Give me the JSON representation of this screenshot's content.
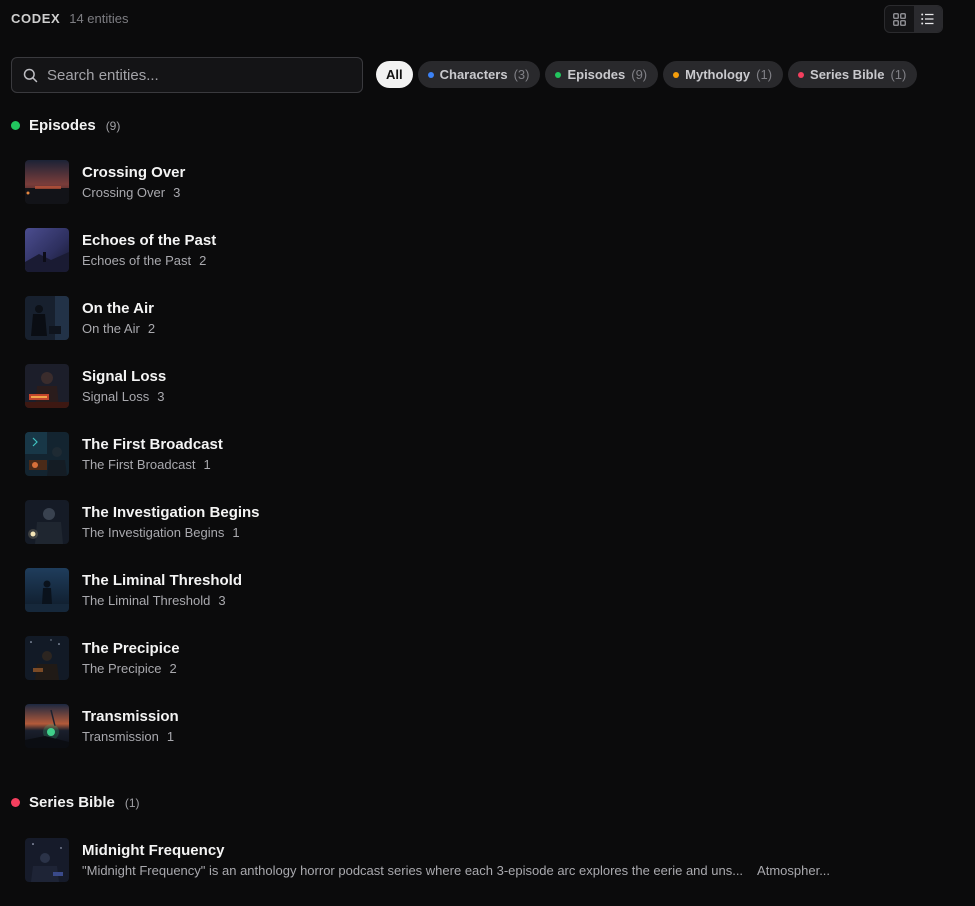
{
  "header": {
    "brand": "CODEX",
    "count": "14 entities"
  },
  "search": {
    "placeholder": "Search entities...",
    "value": ""
  },
  "filters": [
    {
      "label": "All",
      "count": "",
      "color": ""
    },
    {
      "label": "Characters",
      "count": "(3)",
      "color": "#3b82f6"
    },
    {
      "label": "Episodes",
      "count": "(9)",
      "color": "#22c55e"
    },
    {
      "label": "Mythology",
      "count": "(1)",
      "color": "#f59e0b"
    },
    {
      "label": "Series Bible",
      "count": "(1)",
      "color": "#f43f5e"
    }
  ],
  "sections": {
    "episodes": {
      "title": "Episodes",
      "count": "(9)",
      "color": "#22c55e",
      "items": [
        {
          "name": "Crossing Over",
          "sub": "Crossing Over",
          "num": "3"
        },
        {
          "name": "Echoes of the Past",
          "sub": "Echoes of the Past",
          "num": "2"
        },
        {
          "name": "On the Air",
          "sub": "On the Air",
          "num": "2"
        },
        {
          "name": "Signal Loss",
          "sub": "Signal Loss",
          "num": "3"
        },
        {
          "name": "The First Broadcast",
          "sub": "The First Broadcast",
          "num": "1"
        },
        {
          "name": "The Investigation Begins",
          "sub": "The Investigation Begins",
          "num": "1"
        },
        {
          "name": "The Liminal Threshold",
          "sub": "The Liminal Threshold",
          "num": "3"
        },
        {
          "name": "The Precipice",
          "sub": "The Precipice",
          "num": "2"
        },
        {
          "name": "Transmission",
          "sub": "Transmission",
          "num": "1"
        }
      ]
    },
    "series_bible": {
      "title": "Series Bible",
      "count": "(1)",
      "color": "#f43f5e",
      "items": [
        {
          "name": "Midnight Frequency",
          "sub": "\"Midnight Frequency\" is an anthology horror podcast series where each 3-episode arc explores the eerie and uns...",
          "extra": "Atmospher..."
        }
      ]
    }
  },
  "icons": {
    "grid": "grid-view-icon",
    "list": "list-view-icon",
    "search": "search-icon"
  }
}
